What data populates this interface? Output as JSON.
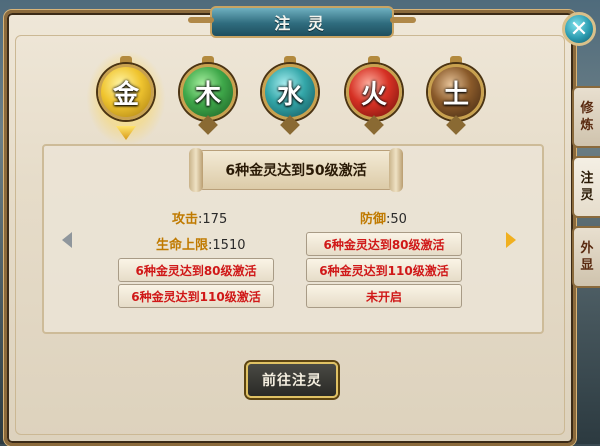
{
  "window": {
    "title": "注 灵",
    "close_icon": "close-icon"
  },
  "elements": [
    {
      "id": "metal",
      "glyph": "金",
      "selected": true
    },
    {
      "id": "wood",
      "glyph": "木",
      "selected": false
    },
    {
      "id": "water",
      "glyph": "水",
      "selected": false
    },
    {
      "id": "fire",
      "glyph": "火",
      "selected": false
    },
    {
      "id": "earth",
      "glyph": "土",
      "selected": false
    }
  ],
  "panel": {
    "banner": "6种金灵达到50级激活",
    "left": {
      "stat1_key": "攻击",
      "stat1_val": ":175",
      "stat2_key": "生命上限",
      "stat2_val": ":1510",
      "cond1": "6种金灵达到80级激活",
      "cond2": "6种金灵达到110级激活"
    },
    "right": {
      "stat1_key": "防御",
      "stat1_val": ":50",
      "cond1": "6种金灵达到80级激活",
      "cond2": "6种金灵达到110级激活",
      "cond3": "未开启"
    }
  },
  "actions": {
    "goto_label": "前往注灵"
  },
  "side_tabs": [
    {
      "chars": [
        "修",
        "炼"
      ],
      "active": false
    },
    {
      "chars": [
        "注",
        "灵"
      ],
      "active": true
    },
    {
      "chars": [
        "外",
        "显"
      ],
      "active": false
    }
  ],
  "colors": {
    "accent_gold": "#c07a00",
    "condition_red": "#d01818",
    "frame": "#8b6a3c"
  }
}
